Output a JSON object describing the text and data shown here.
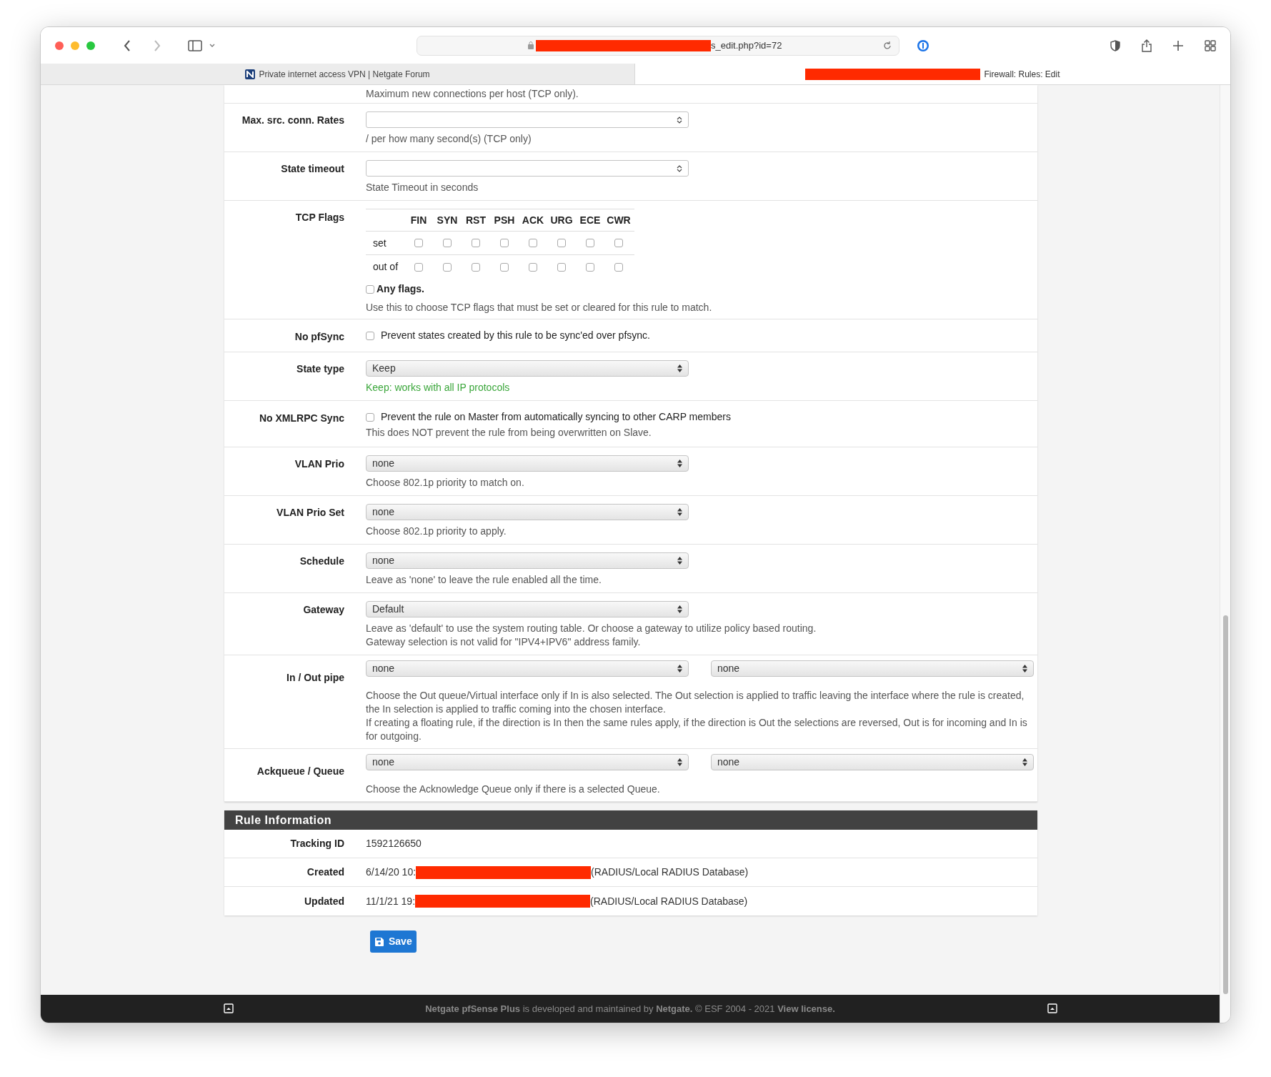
{
  "browser": {
    "url_tail": "s_edit.php?id=72",
    "tabs": [
      {
        "title": "Private internet access VPN | Netgate Forum",
        "selected": false,
        "redacted": false
      },
      {
        "title": "Firewall: Rules: Edit",
        "selected": true,
        "redacted": true
      }
    ]
  },
  "form_rows": [
    {
      "kind": "help_only",
      "label": "",
      "help": [
        {
          "kind": "note",
          "text": "Maximum new connections per host (TCP only)."
        }
      ]
    },
    {
      "kind": "number",
      "label": "Max. src. conn. Rates",
      "help": [
        {
          "kind": "note",
          "text": "/ per how many second(s) (TCP only)"
        }
      ]
    },
    {
      "kind": "number",
      "label": "State timeout",
      "help": [
        {
          "kind": "note",
          "text": "State Timeout in seconds"
        }
      ]
    },
    {
      "kind": "tcp_flags",
      "label": "TCP Flags",
      "flags": [
        "FIN",
        "SYN",
        "RST",
        "PSH",
        "ACK",
        "URG",
        "ECE",
        "CWR"
      ],
      "rows": [
        {
          "label": "set",
          "boxes": [
            {
              "checked": false
            },
            {
              "checked": false
            },
            {
              "checked": false
            },
            {
              "checked": false
            },
            {
              "checked": false
            },
            {
              "checked": false
            },
            {
              "checked": false
            },
            {
              "checked": false
            }
          ]
        },
        {
          "label": "out of",
          "boxes": [
            {
              "checked": false
            },
            {
              "checked": false
            },
            {
              "checked": false
            },
            {
              "checked": false
            },
            {
              "checked": false
            },
            {
              "checked": false
            },
            {
              "checked": false
            },
            {
              "checked": false
            }
          ]
        }
      ],
      "any_flags": {
        "label": "Any flags.",
        "checked": false
      },
      "help": [
        {
          "kind": "note",
          "text": "Use this to choose TCP flags that must be set or cleared for this rule to match."
        }
      ]
    },
    {
      "kind": "checkbox",
      "label": "No pfSync",
      "checked": false,
      "text": "Prevent states created by this rule to be sync'ed over pfsync."
    },
    {
      "kind": "select",
      "label": "State type",
      "values": [
        "Keep"
      ],
      "help": [
        {
          "kind": "success",
          "text": "Keep: works with all IP protocols"
        }
      ]
    },
    {
      "kind": "checkbox",
      "label": "No XMLRPC Sync",
      "checked": false,
      "text": "Prevent the rule on Master from automatically syncing to other CARP members",
      "help": [
        {
          "kind": "note",
          "text": "This does NOT prevent the rule from being overwritten on Slave."
        }
      ]
    },
    {
      "kind": "select",
      "label": "VLAN Prio",
      "values": [
        "none"
      ],
      "help": [
        {
          "kind": "note",
          "text": "Choose 802.1p priority to match on."
        }
      ]
    },
    {
      "kind": "select",
      "label": "VLAN Prio Set",
      "values": [
        "none"
      ],
      "help": [
        {
          "kind": "note",
          "text": "Choose 802.1p priority to apply."
        }
      ]
    },
    {
      "kind": "select",
      "label": "Schedule",
      "values": [
        "none"
      ],
      "help": [
        {
          "kind": "note",
          "text": "Leave as 'none' to leave the rule enabled all the time."
        }
      ]
    },
    {
      "kind": "select",
      "label": "Gateway",
      "values": [
        "Default"
      ],
      "help": [
        {
          "kind": "note",
          "text": "Leave as 'default' to use the system routing table. Or choose a gateway to utilize policy based routing."
        },
        {
          "kind": "note",
          "text": "Gateway selection is not valid for \"IPV4+IPV6\" address family."
        }
      ]
    },
    {
      "kind": "select_pair",
      "label": "In / Out pipe",
      "values": [
        "none",
        "none"
      ],
      "help": [
        {
          "kind": "note",
          "text": "Choose the Out queue/Virtual interface only if In is also selected. The Out selection is applied to traffic leaving the interface where the rule is created, the In selection is applied to traffic coming into the chosen interface."
        },
        {
          "kind": "note",
          "text": "If creating a floating rule, if the direction is In then the same rules apply, if the direction is Out the selections are reversed, Out is for incoming and In is for outgoing."
        }
      ]
    },
    {
      "kind": "select_pair",
      "label": "Ackqueue / Queue",
      "values": [
        "none",
        "none"
      ],
      "help": [
        {
          "kind": "note",
          "text": "Choose the Acknowledge Queue only if there is a selected Queue."
        }
      ]
    }
  ],
  "rule_information": {
    "title": "Rule Information",
    "rows": [
      {
        "label": "Tracking ID",
        "value": "1592126650",
        "redacted": false,
        "after": ""
      },
      {
        "label": "Created",
        "value": "6/14/20 10:",
        "redacted": true,
        "after": "(RADIUS/Local RADIUS Database)"
      },
      {
        "label": "Updated",
        "value": "11/1/21 19:",
        "redacted": true,
        "after": "(RADIUS/Local RADIUS Database)"
      }
    ]
  },
  "save_button": "Save",
  "footer": "**Netgate pfSense Plus** is developed and maintained by **Netgate.** © ESF 2004 - 2021 **View license.**"
}
